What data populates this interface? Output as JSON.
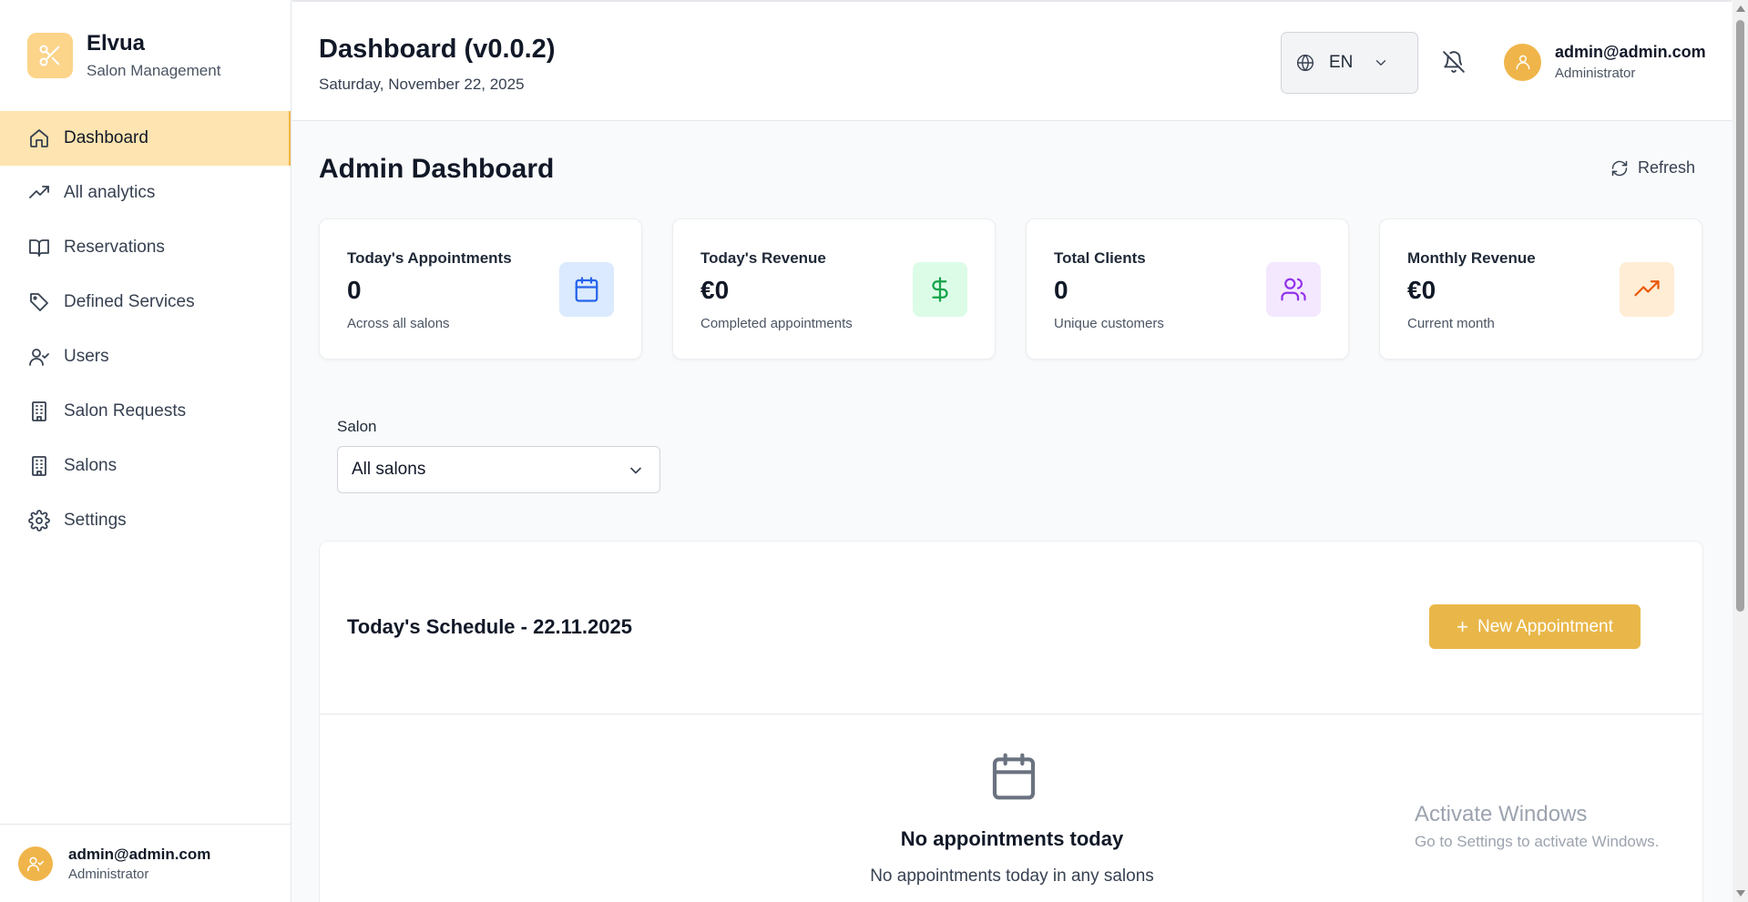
{
  "brand": {
    "name": "Elvua",
    "subtitle": "Salon Management",
    "accent": "#f0b54a"
  },
  "sidebar": {
    "items": [
      {
        "label": "Dashboard",
        "icon": "home-icon",
        "active": true
      },
      {
        "label": "All analytics",
        "icon": "trending-up-icon"
      },
      {
        "label": "Reservations",
        "icon": "book-open-icon"
      },
      {
        "label": "Defined Services",
        "icon": "tag-icon"
      },
      {
        "label": "Users",
        "icon": "user-check-icon"
      },
      {
        "label": "Salon Requests",
        "icon": "building-icon"
      },
      {
        "label": "Salons",
        "icon": "building-icon"
      },
      {
        "label": "Settings",
        "icon": "gear-icon"
      }
    ],
    "footer": {
      "email": "admin@admin.com",
      "role": "Administrator"
    }
  },
  "header": {
    "title": "Dashboard (v0.0.2)",
    "date": "Saturday, November 22, 2025",
    "language": "EN",
    "user": {
      "email": "admin@admin.com",
      "role": "Administrator"
    }
  },
  "main": {
    "title": "Admin Dashboard",
    "refresh_label": "Refresh",
    "cards": [
      {
        "label": "Today's Appointments",
        "value": "0",
        "sub": "Across all salons",
        "icon": "calendar-icon",
        "color": "#2563eb",
        "bg": "#dbeafe"
      },
      {
        "label": "Today's Revenue",
        "value": "€0",
        "sub": "Completed appointments",
        "icon": "dollar-icon",
        "color": "#16a34a",
        "bg": "#dcfce7"
      },
      {
        "label": "Total Clients",
        "value": "0",
        "sub": "Unique customers",
        "icon": "users-icon",
        "color": "#9333ea",
        "bg": "#f3e8ff"
      },
      {
        "label": "Monthly Revenue",
        "value": "€0",
        "sub": "Current month",
        "icon": "trending-up-icon",
        "color": "#ea580c",
        "bg": "#ffedd5"
      }
    ],
    "salon_filter": {
      "label": "Salon",
      "selected": "All salons"
    },
    "schedule": {
      "title": "Today's Schedule - 22.11.2025",
      "new_button": "New Appointment",
      "empty_title": "No appointments today",
      "empty_sub": "No appointments today in any salons"
    }
  },
  "watermark": {
    "title": "Activate Windows",
    "sub": "Go to Settings to activate Windows."
  }
}
